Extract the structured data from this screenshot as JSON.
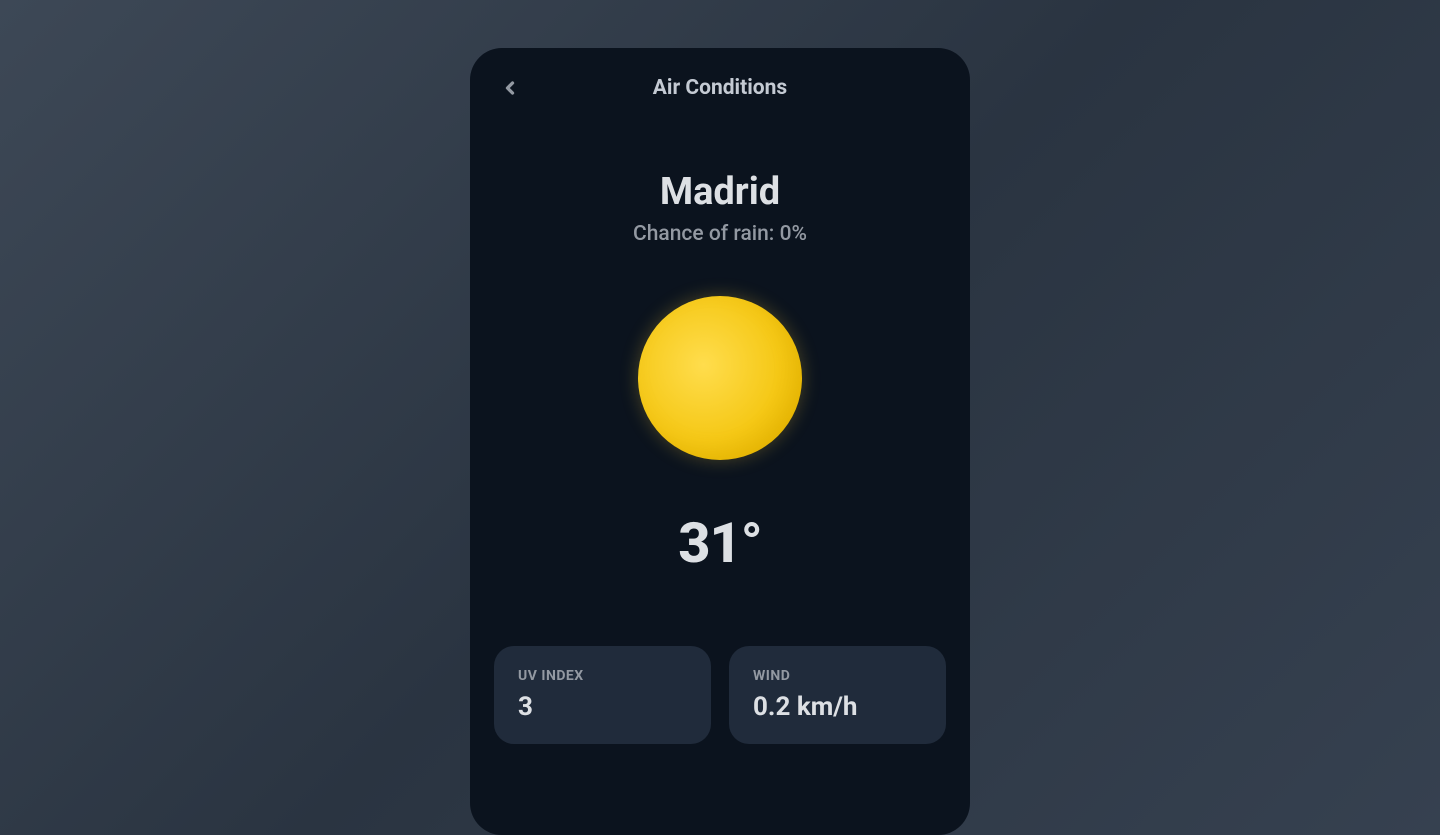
{
  "header": {
    "title": "Air Conditions",
    "back_icon": "chevron-left"
  },
  "location": {
    "city": "Madrid",
    "rain_chance_label": "Chance of rain: 0%"
  },
  "weather": {
    "icon": "sun",
    "temperature": "31°"
  },
  "stats": [
    {
      "label": "UV INDEX",
      "value": "3"
    },
    {
      "label": "WIND",
      "value": "0.2 km/h"
    }
  ]
}
